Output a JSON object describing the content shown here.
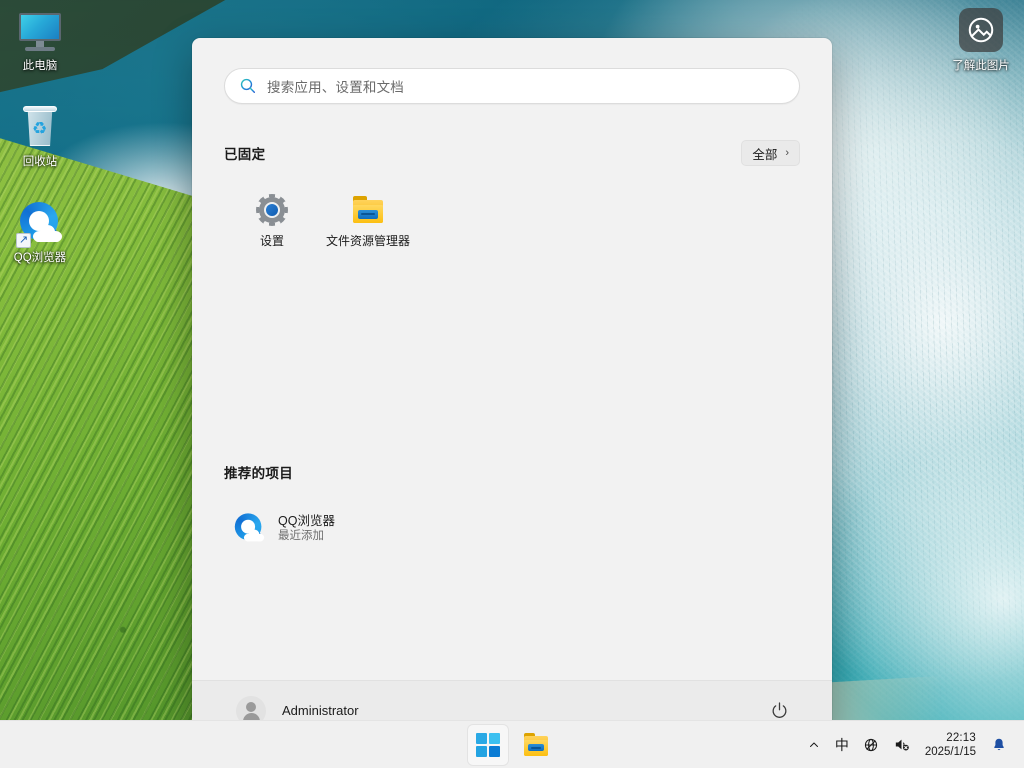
{
  "desktop": {
    "icons": [
      {
        "label": "此电脑",
        "icon": "monitor-icon"
      },
      {
        "label": "回收站",
        "icon": "recycle-bin-icon"
      },
      {
        "label": "QQ浏览器",
        "icon": "qq-browser-icon"
      }
    ],
    "learn_picture": {
      "label": "了解此图片",
      "icon": "image-info-icon"
    }
  },
  "start_menu": {
    "search": {
      "placeholder": "搜索应用、设置和文档",
      "icon": "search-icon"
    },
    "pinned": {
      "title": "已固定",
      "all_button": {
        "label": "全部",
        "chevron": "›"
      },
      "apps": [
        {
          "label": "设置",
          "icon": "settings-gear-icon"
        },
        {
          "label": "文件资源管理器",
          "icon": "folder-icon"
        }
      ]
    },
    "recommended": {
      "title": "推荐的项目",
      "items": [
        {
          "name": "QQ浏览器",
          "subtitle": "最近添加",
          "icon": "qq-browser-icon"
        }
      ]
    },
    "footer": {
      "user": "Administrator",
      "avatar_icon": "user-avatar-icon",
      "power_icon": "power-icon"
    }
  },
  "taskbar": {
    "buttons": [
      {
        "name": "start",
        "icon": "windows-logo-icon",
        "active": true
      },
      {
        "name": "file-explorer",
        "icon": "folder-icon",
        "active": false
      }
    ],
    "tray": {
      "overflow_icon": "chevron-up-icon",
      "ime": "中",
      "network_icon": "network-disconnected-icon",
      "volume_icon": "volume-muted-icon",
      "time": "22:13",
      "date": "2025/1/15",
      "notification_icon": "bell-icon"
    }
  },
  "colors": {
    "menu_bg": "#f2f2f2",
    "footer_bg": "#ebebeb",
    "taskbar_bg": "#f0f0f0",
    "accent": "#0b7cd4",
    "text": "#1b1b1b",
    "muted_text": "#707070"
  }
}
